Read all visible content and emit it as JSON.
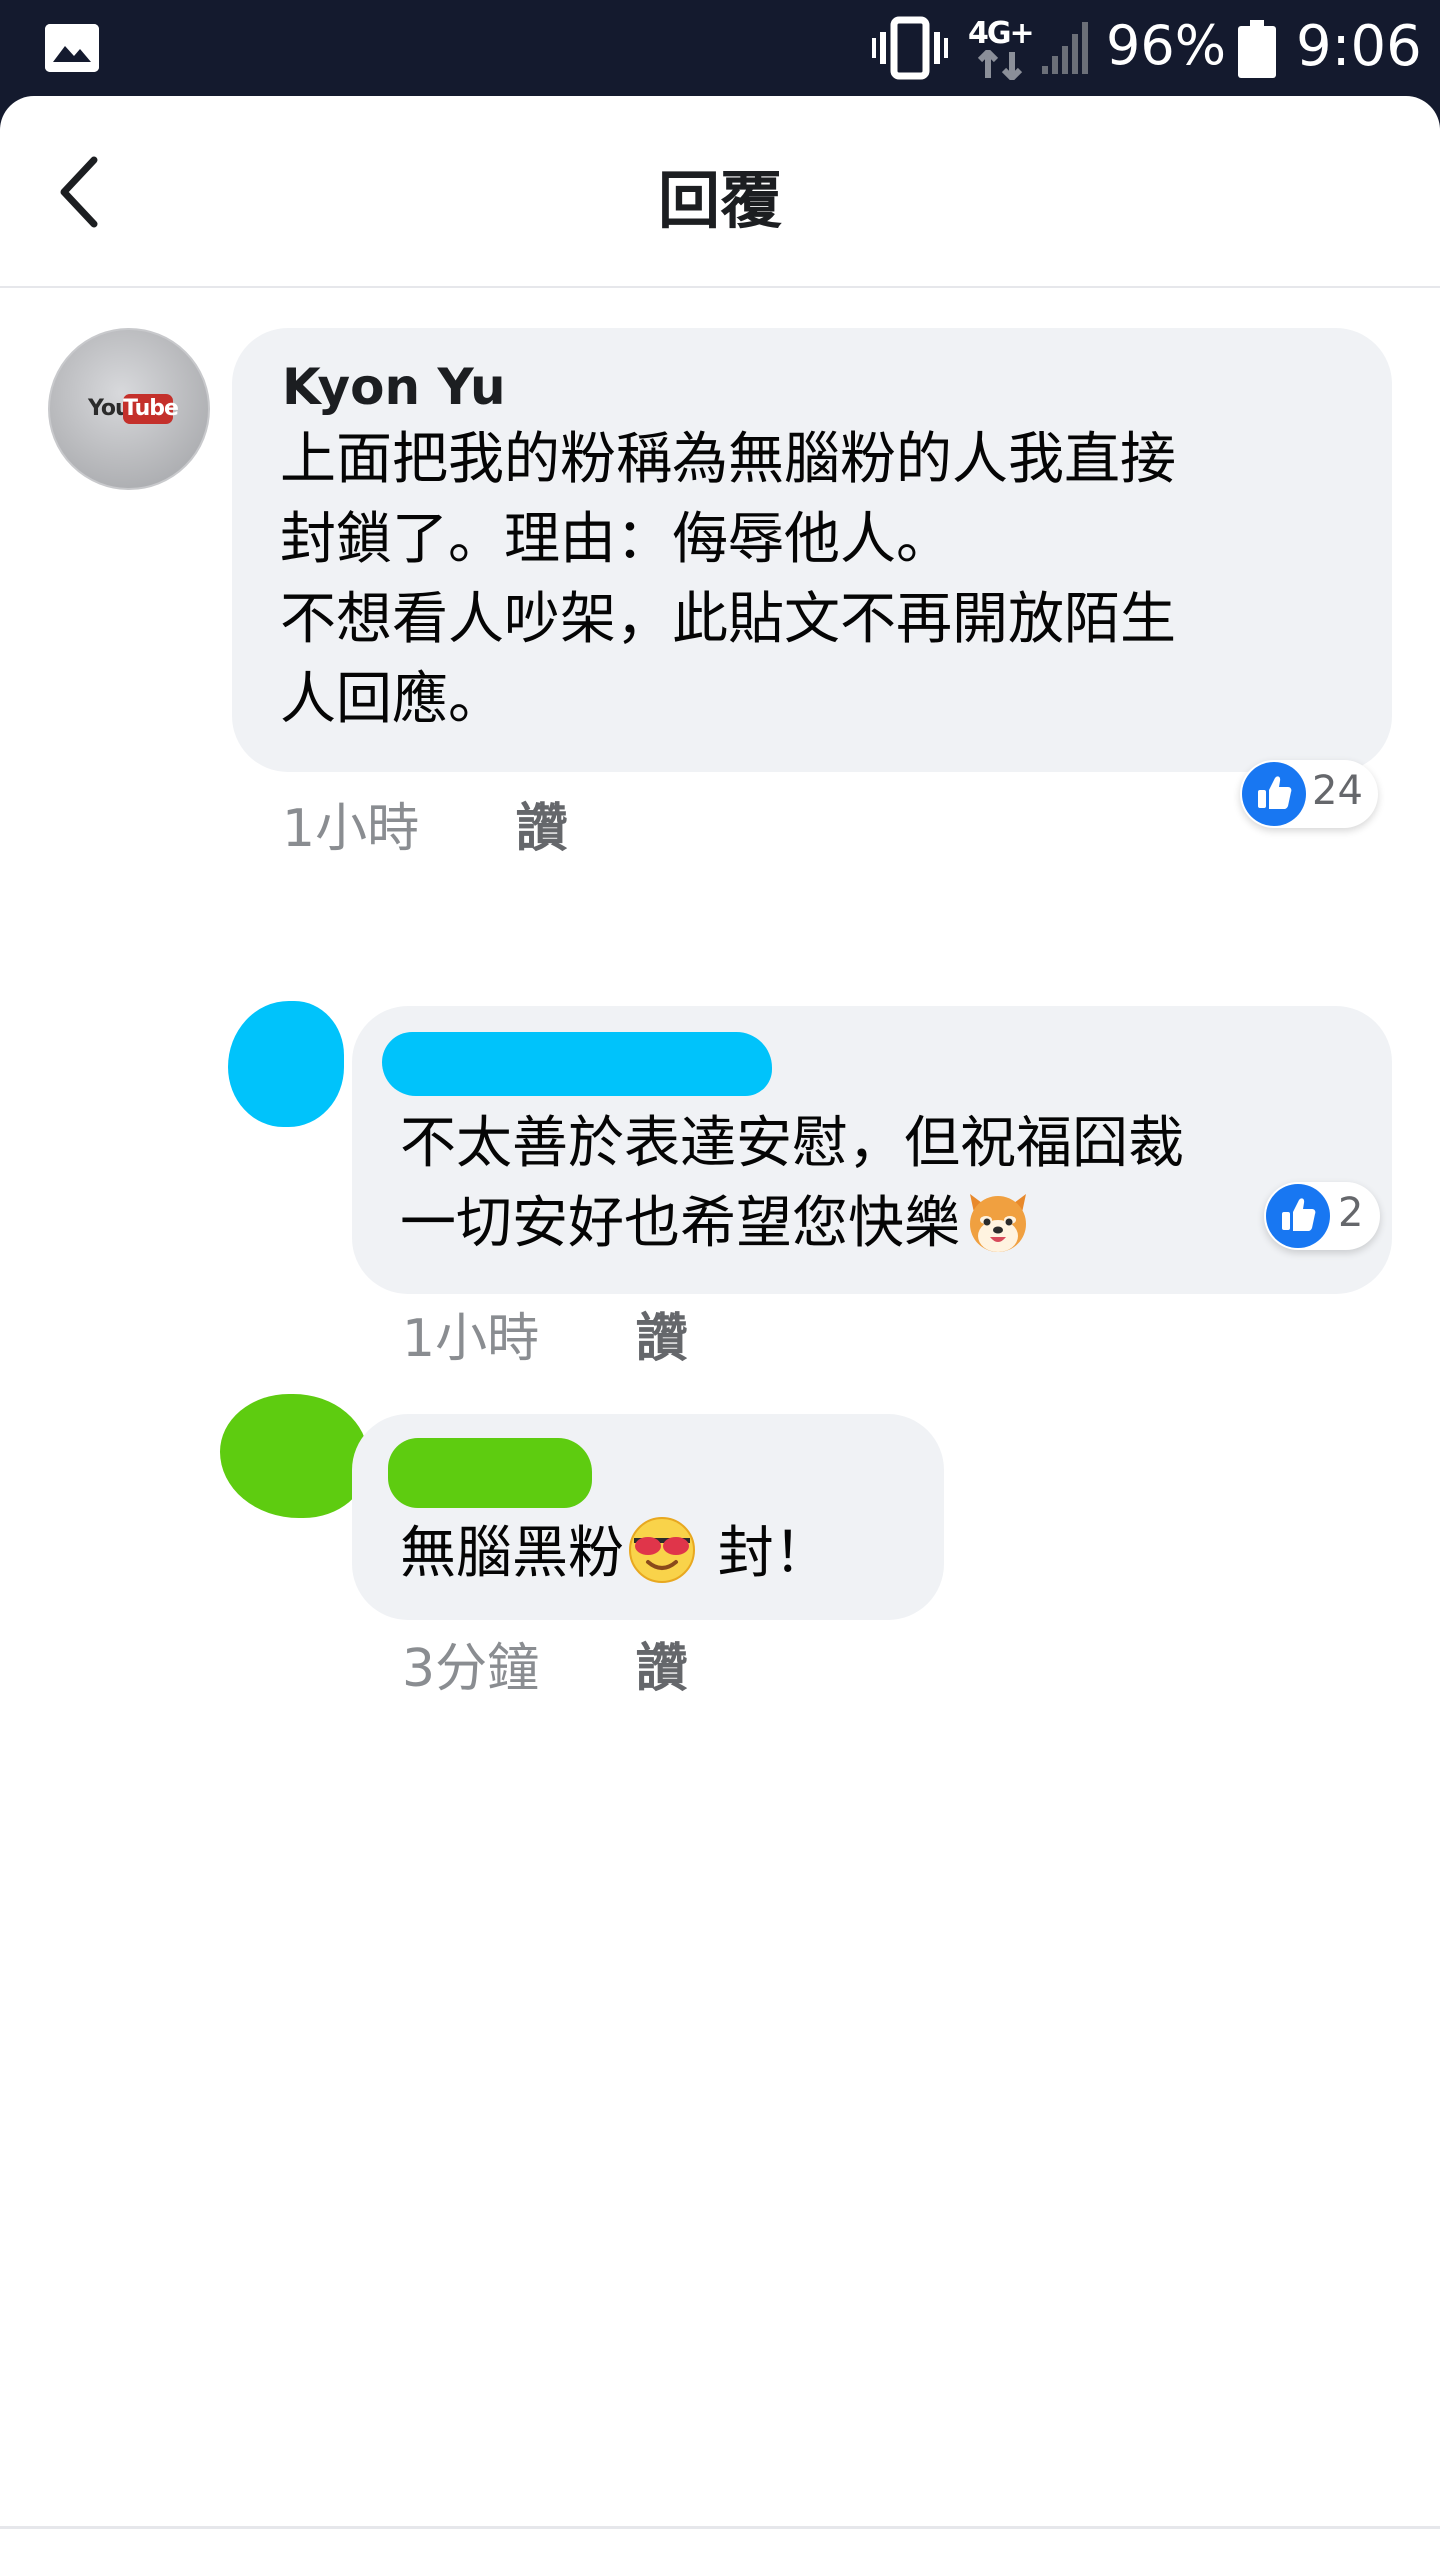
{
  "status_bar": {
    "network": "4G+",
    "battery_percent": "96%",
    "time": "9:06"
  },
  "header": {
    "title": "回覆"
  },
  "comments": [
    {
      "author": "Kyon Yu",
      "avatar_logo": {
        "you": "You",
        "tube": "Tube"
      },
      "text": "上面把我的粉稱為無腦粉的人我直接\n封鎖了。理由：侮辱他人。\n不想看人吵架，此貼文不再開放陌生\n人回應。",
      "time": "1小時",
      "like_label": "讚",
      "reaction_count": "24"
    }
  ],
  "replies": [
    {
      "author_hidden": true,
      "scribble_color": "#00c3fb",
      "text_line1": "不太善於表達安慰，但祝福囧裁",
      "text_line2": "一切安好也希望您快樂",
      "emoji": "dog-face-emoji",
      "time": "1小時",
      "like_label": "讚",
      "reaction_count": "2"
    },
    {
      "author_hidden": true,
      "scribble_color": "#5ecc10",
      "text_before": "無腦黑粉",
      "emoji": "sunglasses-face-emoji",
      "text_after": " 封！",
      "time": "3分鐘",
      "like_label": "讚"
    }
  ],
  "colors": {
    "status_bar_bg": "#141a2e",
    "bubble_bg": "#f0f2f5",
    "like_blue": "#1877f2",
    "meta_gray": "#8a8d91"
  }
}
